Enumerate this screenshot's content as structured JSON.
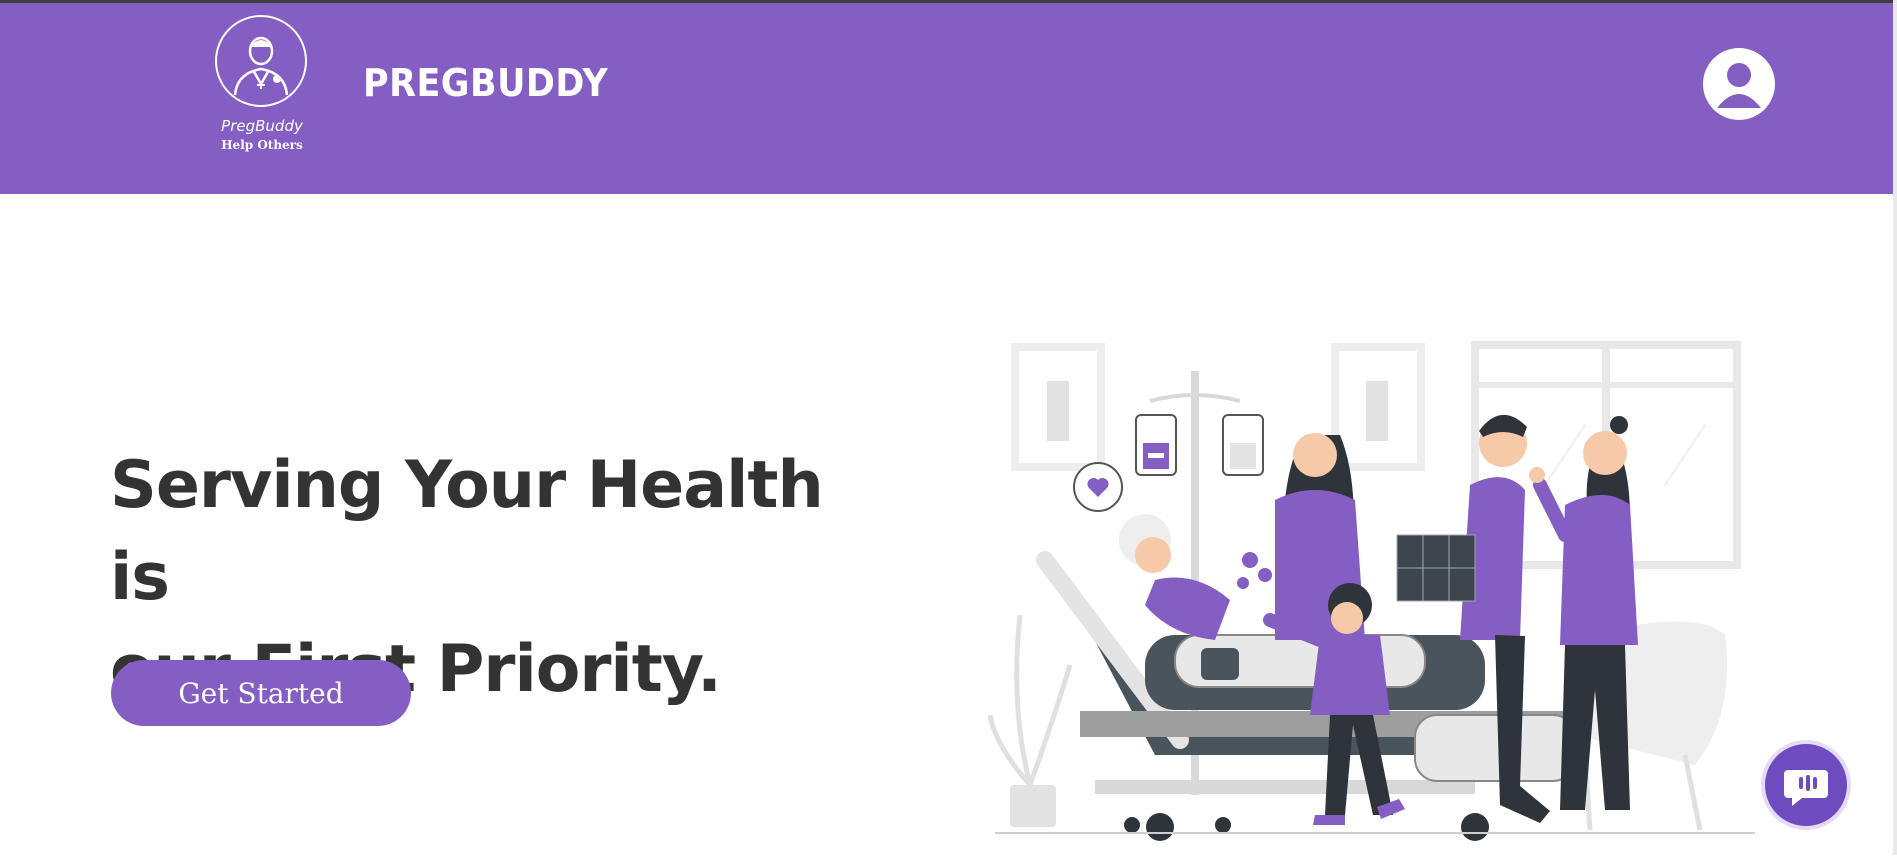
{
  "header": {
    "logo_name": "PregBuddy",
    "logo_tagline": "Help Others",
    "brand": "PREGBUDDY",
    "logo_icon": "doctor-icon",
    "profile_icon": "user-avatar-icon"
  },
  "hero": {
    "title_line1": "Serving Your Health is",
    "title_line2": "our First Priority.",
    "cta_label": "Get Started",
    "illustration": "hospital-visit-illustration"
  },
  "chat": {
    "icon": "chat-bubble-icon"
  },
  "colors": {
    "primary": "#845ec2",
    "heading": "#333333",
    "background": "#ffffff",
    "chat_button": "#6f4bc0"
  }
}
